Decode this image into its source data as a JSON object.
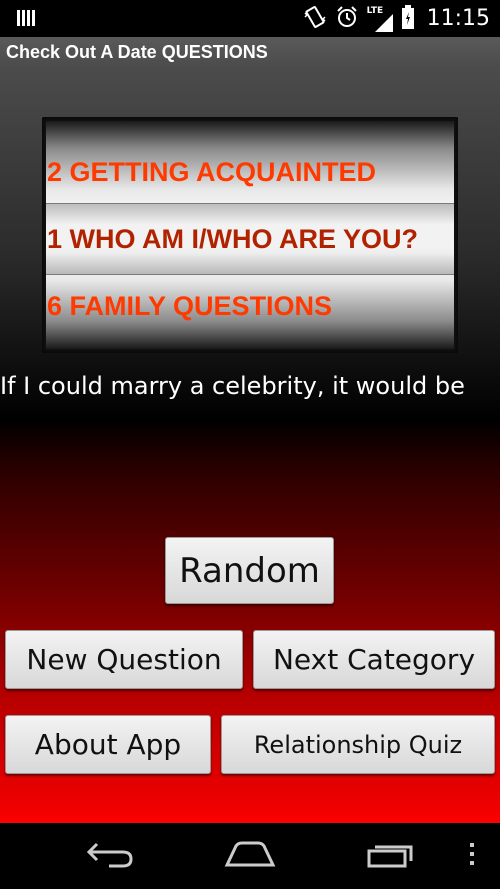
{
  "status_bar": {
    "time": "11:15",
    "network": "LTE",
    "icons": [
      "notification-icon",
      "vibrate-icon",
      "alarm-icon",
      "signal-icon",
      "battery-icon"
    ]
  },
  "app": {
    "title": "Check Out A Date QUESTIONS"
  },
  "picker": {
    "items": [
      "2 GETTING ACQUAINTED",
      "1 WHO AM I/WHO ARE YOU?",
      "6 FAMILY QUESTIONS"
    ],
    "selected_index": 1
  },
  "question": {
    "text": "If I could marry a celebrity, it would be"
  },
  "buttons": {
    "random": "Random",
    "new_question": "New Question",
    "next_category": "Next Category",
    "about_app": "About App",
    "relationship_quiz": "Relationship Quiz"
  },
  "nav": {
    "icons": [
      "back-icon",
      "home-icon",
      "recent-apps-icon",
      "overflow-menu-icon"
    ]
  },
  "colors": {
    "picker_text": "#ff3a00",
    "picker_selected_text": "#b02200",
    "background_bottom": "#ff0000"
  }
}
